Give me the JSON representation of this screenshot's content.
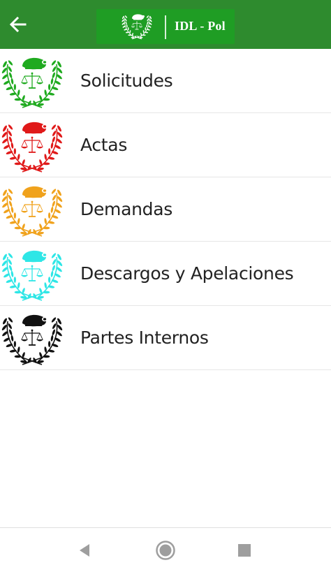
{
  "appbar": {
    "back_icon": "arrow-left-icon",
    "logo_emblem_icon": "police-cap-scales-laurel-emblem",
    "logo_text": "IDL - Pol",
    "color": "#2e8b2e"
  },
  "menu": {
    "items": [
      {
        "label": "Solicitudes",
        "emblem_icon": "police-cap-scales-laurel-emblem",
        "color": "#1faa1f"
      },
      {
        "label": "Actas",
        "emblem_icon": "police-cap-scales-laurel-emblem",
        "color": "#e01919"
      },
      {
        "label": "Demandas",
        "emblem_icon": "police-cap-scales-laurel-emblem",
        "color": "#f0a21c"
      },
      {
        "label": "Descargos y Apelaciones",
        "emblem_icon": "police-cap-scales-laurel-emblem",
        "color": "#2ee6e6"
      },
      {
        "label": "Partes Internos",
        "emblem_icon": "police-cap-scales-laurel-emblem",
        "color": "#111111"
      }
    ]
  },
  "navbar": {
    "back_icon": "triangle-back-icon",
    "home_icon": "circle-home-icon",
    "recents_icon": "square-recents-icon"
  }
}
